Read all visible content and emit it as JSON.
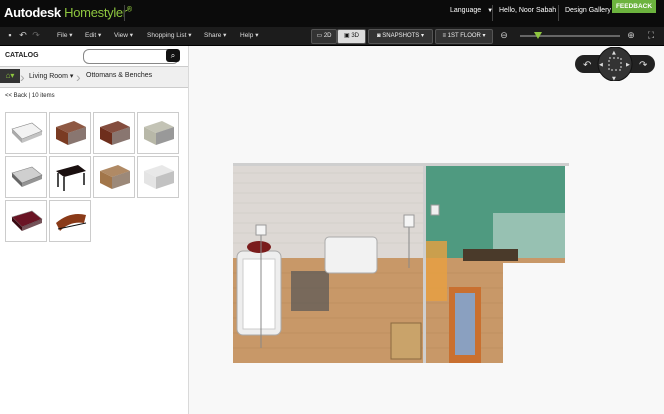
{
  "app": {
    "brand": "Autodesk",
    "product": "Homestyler",
    "trademark": "®"
  },
  "topbar": {
    "language": "Language",
    "language_arrow": "▼",
    "user_greeting": "Hello, Noor Sabah",
    "design_gallery": "Design Gallery",
    "feedback": "FEEDBACK"
  },
  "menu": {
    "items": [
      {
        "label": "File",
        "arrow": "▾"
      },
      {
        "label": "Edit",
        "arrow": "▾"
      },
      {
        "label": "View",
        "arrow": "▾"
      },
      {
        "label": "Shopping List",
        "arrow": "▾"
      },
      {
        "label": "Share",
        "arrow": "▾"
      },
      {
        "label": "Help",
        "arrow": "▾"
      }
    ],
    "btn_2d": "2D",
    "btn_3d": "3D",
    "snapshots": "SNAPSHOTS",
    "floor": "1ST FLOOR"
  },
  "catalog": {
    "title": "CATALOG",
    "search_placeholder": "",
    "crumbs": [
      "Living Room",
      "Ottomans & Benches"
    ],
    "crumb_arrow": "▾",
    "back": "<< Back",
    "count": "10 items",
    "items": [
      {
        "color": "#f2f2f2",
        "leg": "#aaa",
        "kind": "bench"
      },
      {
        "color": "#7a3b22",
        "leg": "#3a1a10",
        "kind": "ottoman"
      },
      {
        "color": "#6e2e1c",
        "leg": "#3a1a10",
        "kind": "ottoman"
      },
      {
        "color": "#b8b8a8",
        "leg": "#555",
        "kind": "ottoman"
      },
      {
        "color": "#cfcfcf",
        "leg": "#666",
        "kind": "bench"
      },
      {
        "color": "#1a1010",
        "leg": "#111",
        "kind": "table"
      },
      {
        "color": "#a2764a",
        "leg": "#5a3a20",
        "kind": "ottoman"
      },
      {
        "color": "#e4e4e4",
        "leg": "#999",
        "kind": "ottoman"
      },
      {
        "color": "#6a1424",
        "leg": "#3a0a12",
        "kind": "bench"
      },
      {
        "color": "#8a3a18",
        "leg": "#111",
        "kind": "chaise"
      }
    ]
  },
  "colors": {
    "accent": "#8ec63f",
    "feedback_bg": "#6cb33e",
    "wall_green": "#4f9a80",
    "floor_wood": "#c89868"
  },
  "zoom_level_fraction": 0.18
}
